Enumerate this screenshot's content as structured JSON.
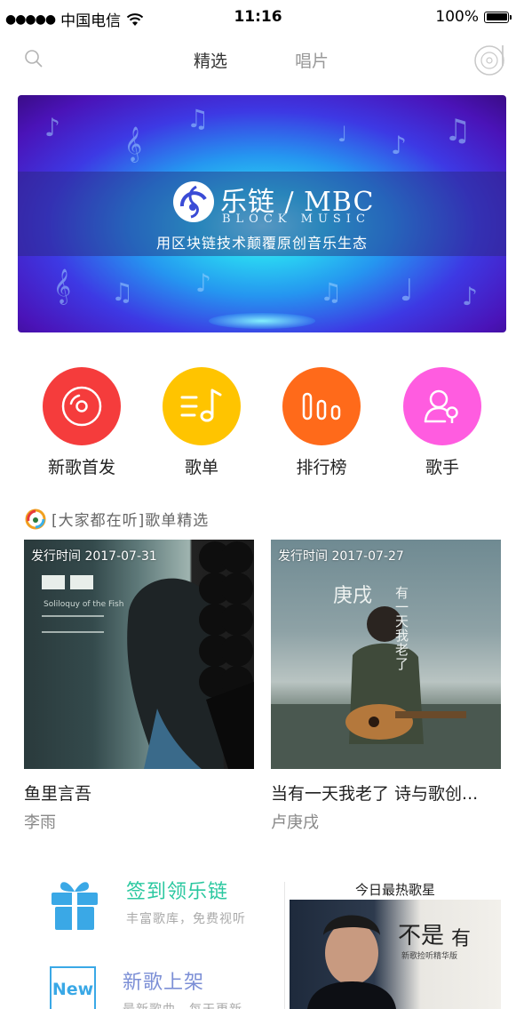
{
  "status_bar": {
    "signal": "●●●●●",
    "carrier": "中国电信",
    "time": "11:16",
    "battery_text": "100%"
  },
  "nav": {
    "tabs": [
      {
        "label": "精选",
        "active": true
      },
      {
        "label": "唱片",
        "active": false
      }
    ]
  },
  "banner": {
    "title": "乐链 / MBC",
    "subtitle": "BLOCK MUSIC",
    "slogan": "用区块链技术颠覆原创音乐生态"
  },
  "quick_menu": [
    {
      "label": "新歌首发",
      "color": "#f53c3c",
      "icon": "disc-icon"
    },
    {
      "label": "歌单",
      "color": "#ffc400",
      "icon": "playlist-icon"
    },
    {
      "label": "排行榜",
      "color": "#ff6a1a",
      "icon": "chart-bars-icon"
    },
    {
      "label": "歌手",
      "color": "#ff5ce0",
      "icon": "singer-icon"
    }
  ],
  "section": {
    "title": "[大家都在听]歌单精选"
  },
  "playlists": [
    {
      "release_date": "发行时间 2017-07-31",
      "title": "鱼里言吾",
      "artist": "李雨",
      "cover_text": "Soliloquy of the Fish"
    },
    {
      "release_date": "发行时间 2017-07-27",
      "title": "当有一天我老了 诗与歌创...",
      "artist": "卢庚戌",
      "cover_text_1": "庚戌",
      "cover_text_2": "有一天我老了"
    }
  ],
  "promos": [
    {
      "title": "签到领乐链",
      "subtitle": "丰富歌库，免费视听",
      "color": "#2bc8a0",
      "icon": "gift-icon"
    },
    {
      "title": "新歌上架",
      "subtitle": "最新歌曲，每天更新",
      "color": "#7c8fd6",
      "icon": "new-badge-icon",
      "badge": "New"
    }
  ],
  "hot_star": {
    "title": "今日最热歌星",
    "cover_text_1": "不是",
    "cover_text_2": "有",
    "cover_text_3": "新歌捡听精华版"
  }
}
